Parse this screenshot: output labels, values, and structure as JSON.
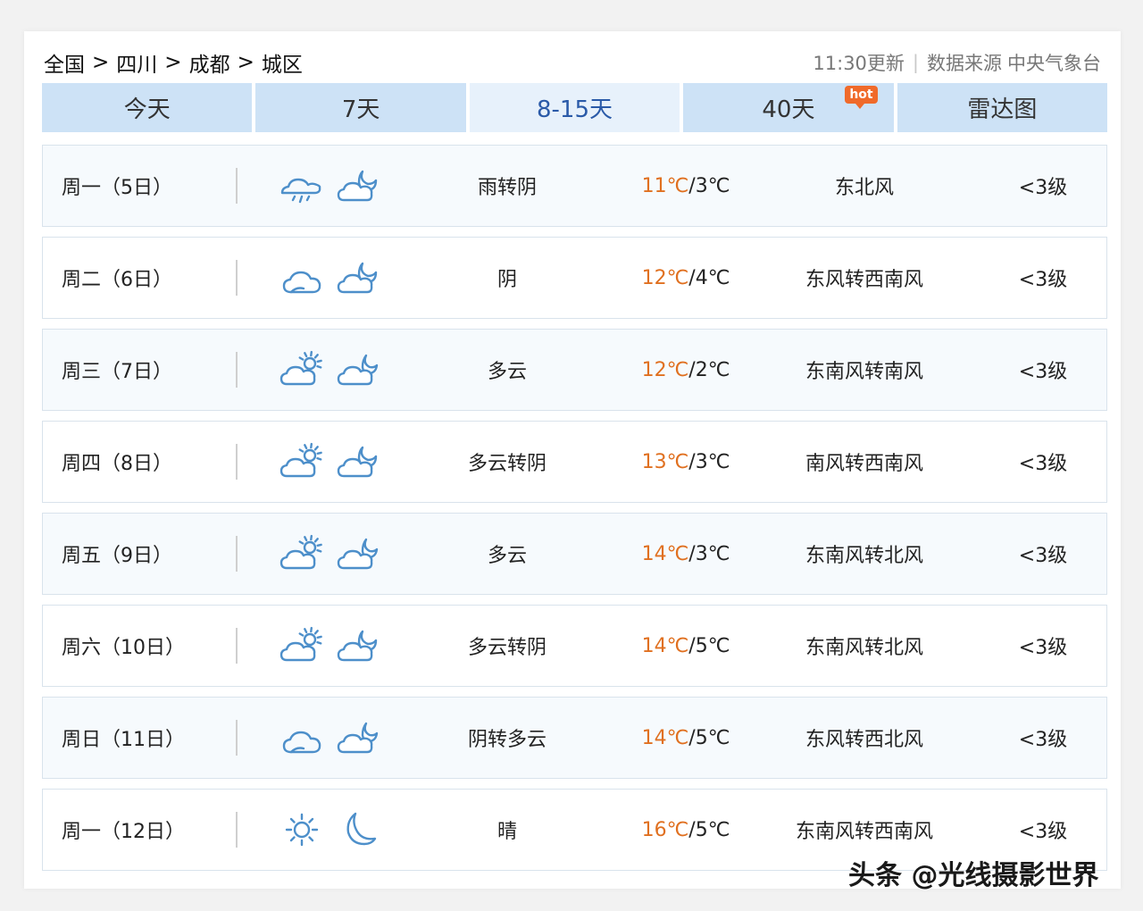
{
  "breadcrumb": {
    "items": [
      "全国",
      "四川",
      "成都",
      "城区"
    ],
    "separator": ">"
  },
  "meta": {
    "update": "11:30更新",
    "divider": "|",
    "source_label": "数据来源",
    "source": "中央气象台"
  },
  "tabs": [
    {
      "label": "今天",
      "active": false
    },
    {
      "label": "7天",
      "active": false
    },
    {
      "label": "8-15天",
      "active": true
    },
    {
      "label": "40天",
      "active": false,
      "badge": "hot"
    },
    {
      "label": "雷达图",
      "active": false
    }
  ],
  "colors": {
    "accent": "#2a5aa8",
    "tab_bg": "#cde2f6",
    "high_temp": "#e07020",
    "icon": "#4d8fca",
    "badge": "#f06a2a"
  },
  "forecast": [
    {
      "date": "周一（5日）",
      "day_icon": "rain-cloud-icon",
      "night_icon": "cloud-moon-icon",
      "desc": "雨转阴",
      "high": "11℃",
      "low": "/3℃",
      "wind": "东北风",
      "level": "<3级"
    },
    {
      "date": "周二（6日）",
      "day_icon": "cloud-icon",
      "night_icon": "cloud-moon-icon",
      "desc": "阴",
      "high": "12℃",
      "low": "/4℃",
      "wind": "东风转西南风",
      "level": "<3级"
    },
    {
      "date": "周三（7日）",
      "day_icon": "cloud-sun-icon",
      "night_icon": "moon-cloud-icon",
      "desc": "多云",
      "high": "12℃",
      "low": "/2℃",
      "wind": "东南风转南风",
      "level": "<3级"
    },
    {
      "date": "周四（8日）",
      "day_icon": "cloud-sun-icon",
      "night_icon": "cloud-moon-icon",
      "desc": "多云转阴",
      "high": "13℃",
      "low": "/3℃",
      "wind": "南风转西南风",
      "level": "<3级"
    },
    {
      "date": "周五（9日）",
      "day_icon": "cloud-sun-icon",
      "night_icon": "moon-cloud-icon",
      "desc": "多云",
      "high": "14℃",
      "low": "/3℃",
      "wind": "东南风转北风",
      "level": "<3级"
    },
    {
      "date": "周六（10日）",
      "day_icon": "cloud-sun-icon",
      "night_icon": "cloud-moon-icon",
      "desc": "多云转阴",
      "high": "14℃",
      "low": "/5℃",
      "wind": "东南风转北风",
      "level": "<3级"
    },
    {
      "date": "周日（11日）",
      "day_icon": "cloud-icon",
      "night_icon": "moon-cloud-icon",
      "desc": "阴转多云",
      "high": "14℃",
      "low": "/5℃",
      "wind": "东风转西北风",
      "level": "<3级"
    },
    {
      "date": "周一（12日）",
      "day_icon": "sun-icon",
      "night_icon": "moon-icon",
      "desc": "晴",
      "high": "16℃",
      "low": "/5℃",
      "wind": "东南风转西南风",
      "level": "<3级"
    }
  ],
  "watermark": "头条 @光线摄影世界"
}
